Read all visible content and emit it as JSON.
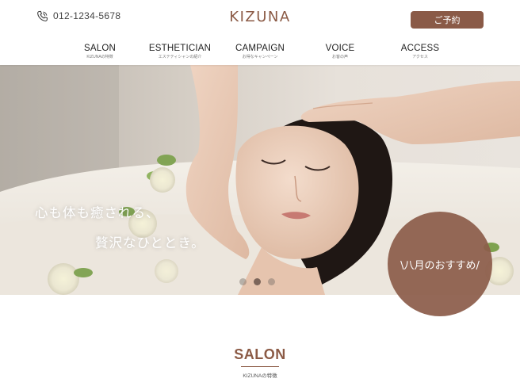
{
  "header": {
    "phone": "012-1234-5678",
    "logo": "KIZUNA",
    "reserve_label": "ご予約"
  },
  "nav": [
    {
      "en": "SALON",
      "jp": "KIZUNAの特徴"
    },
    {
      "en": "ESTHETICIAN",
      "jp": "エステティシャンの紹介"
    },
    {
      "en": "CAMPAIGN",
      "jp": "お得なキャンペーン"
    },
    {
      "en": "VOICE",
      "jp": "お客の声"
    },
    {
      "en": "ACCESS",
      "jp": "アクセス"
    }
  ],
  "hero": {
    "copy_line1": "心も体も癒される、",
    "copy_line2": "贅沢なひととき。",
    "slides_total": 3,
    "active_slide": 2
  },
  "promo": {
    "label": "\\八月のおすすめ/"
  },
  "salon": {
    "title": "SALON",
    "subtitle": "KIZUNAの特徴"
  },
  "colors": {
    "brand": "#8b5a45",
    "button": "#8a5a47",
    "promo": "#8c5d4a"
  }
}
